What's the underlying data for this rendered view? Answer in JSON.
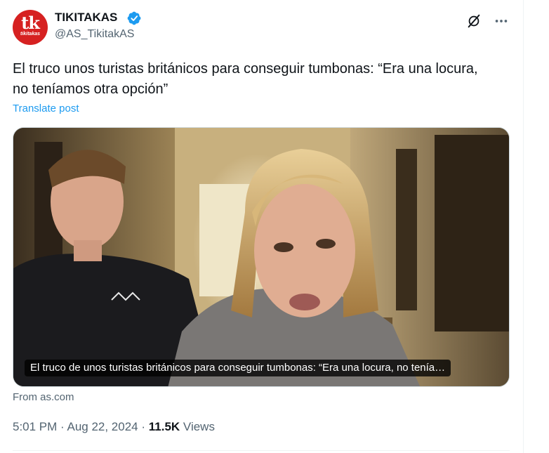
{
  "author": {
    "display_name": "TIKITAKAS",
    "handle": "@AS_TikitakAS",
    "avatar_text": "tk",
    "avatar_subtext": "tikitakas",
    "avatar_color": "#d62121",
    "verified": true,
    "verified_color": "#1d9bf0"
  },
  "header_icons": [
    "grok-icon",
    "more-icon"
  ],
  "tweet": {
    "text": "El truco unos turistas británicos para conseguir tumbonas: “Era una locura, no teníamos otra opción”",
    "translate_label": "Translate post"
  },
  "card": {
    "caption": "El truco de unos turistas británicos para conseguir tumbonas: “Era una locura, no tenía…",
    "source": "From as.com"
  },
  "meta": {
    "time": "5:01 PM",
    "date": "Aug 22, 2024",
    "separator": " · ",
    "views_count": "11.5K",
    "views_label": "Views"
  },
  "colors": {
    "link": "#1d9bf0",
    "secondary_text": "#536471",
    "primary_text": "#0f1419",
    "border": "#eff3f4"
  }
}
